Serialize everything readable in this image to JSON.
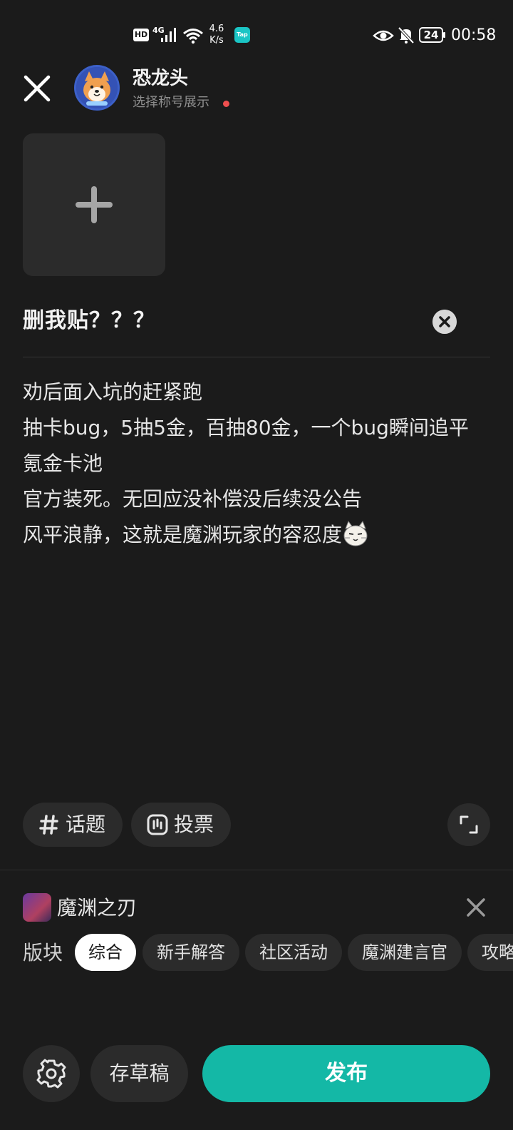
{
  "status_bar": {
    "hd": "HD",
    "network": "4G",
    "speed_value": "4.6",
    "speed_unit": "K/s",
    "tap_label": "Tap",
    "battery": "24",
    "time": "00:58"
  },
  "header": {
    "username": "恐龙头",
    "subtitle": "选择称号展示"
  },
  "post": {
    "title": "删我贴？？？",
    "body_lines": [
      "劝后面入坑的赶紧跑",
      "抽卡bug，5抽5金，百抽80金，一个bug瞬间追平",
      "氪金卡池",
      "官方装死。无回应没补偿没后续没公告",
      "风平浪静，这就是魔渊玩家的容忍度"
    ]
  },
  "toolbar": {
    "topic_label": "话题",
    "vote_label": "投票"
  },
  "game": {
    "name": "魔渊之刃"
  },
  "section": {
    "label": "版块",
    "tags": [
      "综合",
      "新手解答",
      "社区活动",
      "魔渊建言官",
      "攻略"
    ],
    "selected": "综合"
  },
  "bottom": {
    "draft_label": "存草稿",
    "publish_label": "发布"
  },
  "colors": {
    "background": "#1b1b1b",
    "accent": "#14b8a6",
    "notification_dot": "#ef4f4f"
  }
}
